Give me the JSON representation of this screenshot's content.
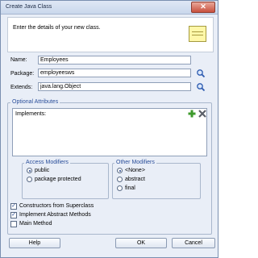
{
  "window": {
    "title": "Create Java Class"
  },
  "header": {
    "text": "Enter the details of your new class."
  },
  "form": {
    "name_label": "Name:",
    "name_value": "Employees",
    "package_label": "Package:",
    "package_value": "employeesws",
    "extends_label": "Extends:",
    "extends_value": "java.lang.Object"
  },
  "optional": {
    "title": "Optional Attributes",
    "implements_label": "Implements:"
  },
  "access": {
    "title": "Access Modifiers",
    "options": [
      "public",
      "package protected"
    ],
    "selected": "public"
  },
  "other": {
    "title": "Other Modifiers",
    "options": [
      "<None>",
      "abstract",
      "final"
    ],
    "selected": "<None>"
  },
  "checks": [
    {
      "label": "Constructors from Superclass",
      "checked": true
    },
    {
      "label": "Implement Abstract Methods",
      "checked": true
    },
    {
      "label": "Main Method",
      "checked": false
    }
  ],
  "buttons": {
    "help": "Help",
    "ok": "OK",
    "cancel": "Cancel"
  },
  "icons": [
    "close-icon",
    "note-icon",
    "search-icon",
    "add-icon",
    "remove-icon"
  ],
  "colors": {
    "accent": "#2a4e9a",
    "dialog_bg": "#e9eef7",
    "close": "#c9503d"
  }
}
